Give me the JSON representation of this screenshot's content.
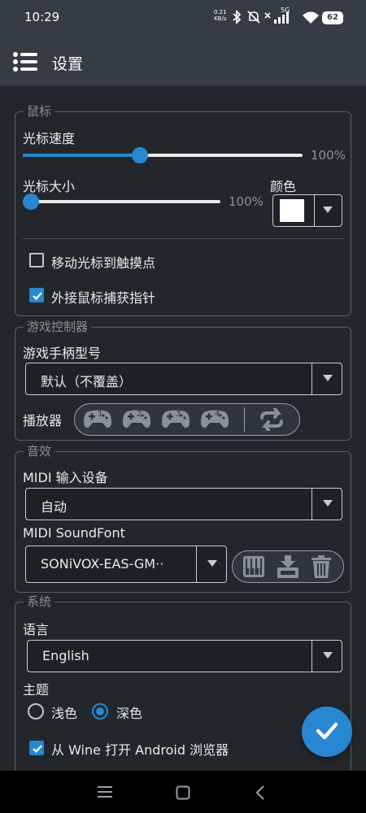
{
  "status_bar": {
    "time": "10:29",
    "net_speed_value": "0.21",
    "net_speed_unit": "KB/s",
    "signal_label": "5G",
    "battery": "62",
    "icons": [
      "bluetooth-icon",
      "mute-icon",
      "signal-icon",
      "wifi-icon",
      "battery-icon"
    ]
  },
  "app_bar": {
    "title": "设置",
    "menu_icon": "hamburger-menu-icon"
  },
  "mouse": {
    "legend": "鼠标",
    "speed_label": "光标速度",
    "speed_value_text": "100%",
    "speed_fraction": 0.42,
    "size_label": "光标大小",
    "size_value_text": "100%",
    "size_fraction": 0.0,
    "color_label": "颜色",
    "color_value": "#ffffff",
    "move_to_touch_label": "移动光标到触摸点",
    "move_to_touch_checked": false,
    "capture_pointer_label": "外接鼠标捕获指针",
    "capture_pointer_checked": true
  },
  "game_controller": {
    "legend": "游戏控制器",
    "model_label": "游戏手柄型号",
    "model_value": "默认（不覆盖）",
    "players_label": "播放器",
    "players": [
      "1",
      "2",
      "3",
      "4"
    ],
    "swap_icon": "swap-icon"
  },
  "audio": {
    "legend": "音效",
    "midi_input_label": "MIDI 输入设备",
    "midi_input_value": "自动",
    "soundfont_label": "MIDI SoundFont",
    "soundfont_value": "SONiVOX-EAS-GM··",
    "actions": [
      "piano-icon",
      "download-icon",
      "trash-icon"
    ]
  },
  "system": {
    "legend": "系统",
    "language_label": "语言",
    "language_value": "English",
    "theme_label": "主题",
    "theme_light": "浅色",
    "theme_dark": "深色",
    "theme_selected": "深色",
    "open_browser_label": "从 Wine 打开 Android 浏览器",
    "open_browser_checked": true
  },
  "colors": {
    "accent": "#2787d0",
    "background": "#23272c",
    "bar": "#363c44"
  }
}
